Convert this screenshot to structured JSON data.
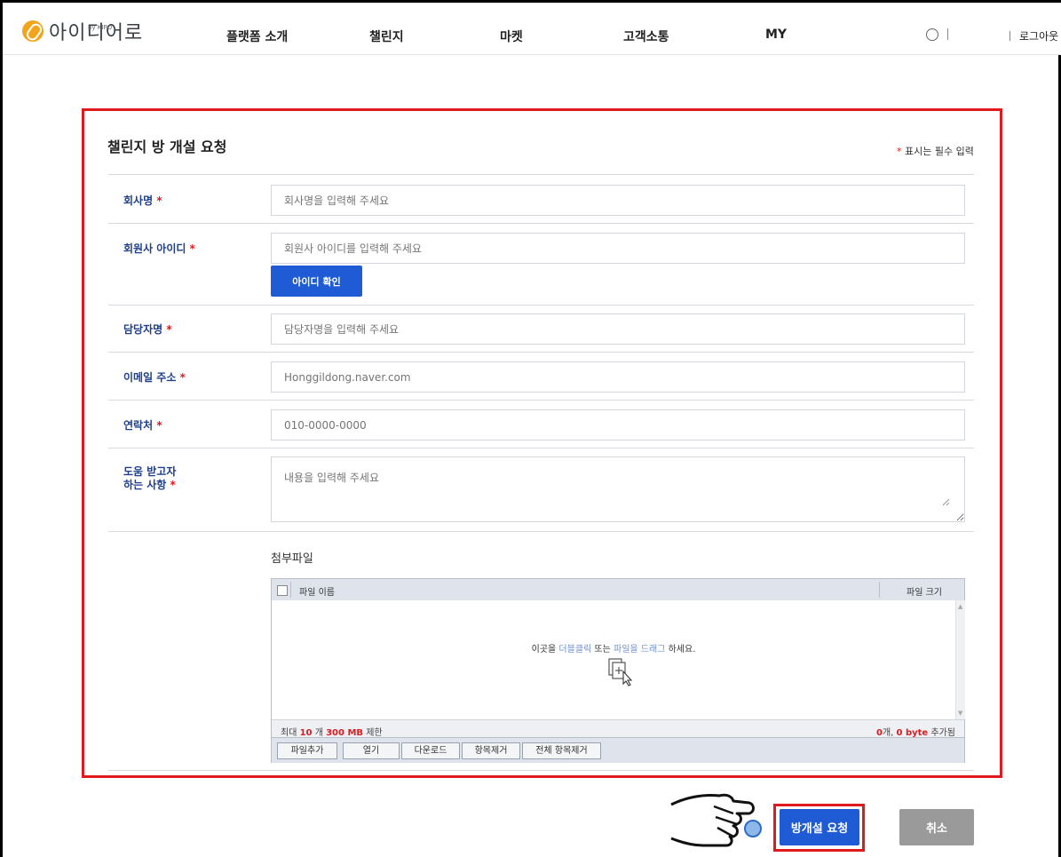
{
  "header": {
    "logo_text": "아이디어로",
    "logo_sub": "by KIPO",
    "nav": [
      "플랫폼 소개",
      "챌린지",
      "마켓",
      "고객소통",
      "MY"
    ],
    "logout": "로그아웃"
  },
  "form": {
    "title": "챌린지 방 개설 요청",
    "required_note": "표시는 필수 입력",
    "required_star": "*",
    "fields": [
      {
        "label": "회사명",
        "placeholder": "회사명을 입력해 주세요"
      },
      {
        "label": "회원사 아이디",
        "placeholder": "회원사 아이디를 입력해 주세요",
        "button": "아이디 확인"
      },
      {
        "label": "담당자명",
        "placeholder": "담당자명을 입력해 주세요"
      },
      {
        "label": "이메일 주소",
        "placeholder": "Honggildong.naver.com"
      },
      {
        "label": "연락처",
        "placeholder": "010-0000-0000"
      },
      {
        "label_line1": "도움 받고자",
        "label_line2": "하는 사항",
        "placeholder": "내용을 입력해 주세요"
      }
    ]
  },
  "attachment": {
    "title": "첨부파일",
    "col_name": "파일 이름",
    "col_size": "파일 크기",
    "drop_pre": "이곳을",
    "drop_link1": "더블클릭",
    "drop_mid": "또는",
    "drop_link2": "파일을 드래그",
    "drop_post": "하세요.",
    "limit_pre": "최대",
    "limit_count": "10",
    "limit_mid": "개",
    "limit_size": "300 MB",
    "limit_post": "제한",
    "added_count": "0",
    "added_mid": "개,",
    "added_size": "0 byte",
    "added_post": "추가됨",
    "buttons": [
      "파일추가",
      "열기",
      "다운로드",
      "항목제거",
      "전체 항목제거"
    ]
  },
  "actions": {
    "submit": "방개설 요청",
    "cancel": "취소"
  },
  "colors": {
    "accent": "#1e5bd4",
    "highlight": "#e0191e",
    "cancel": "#9a9a9a"
  }
}
